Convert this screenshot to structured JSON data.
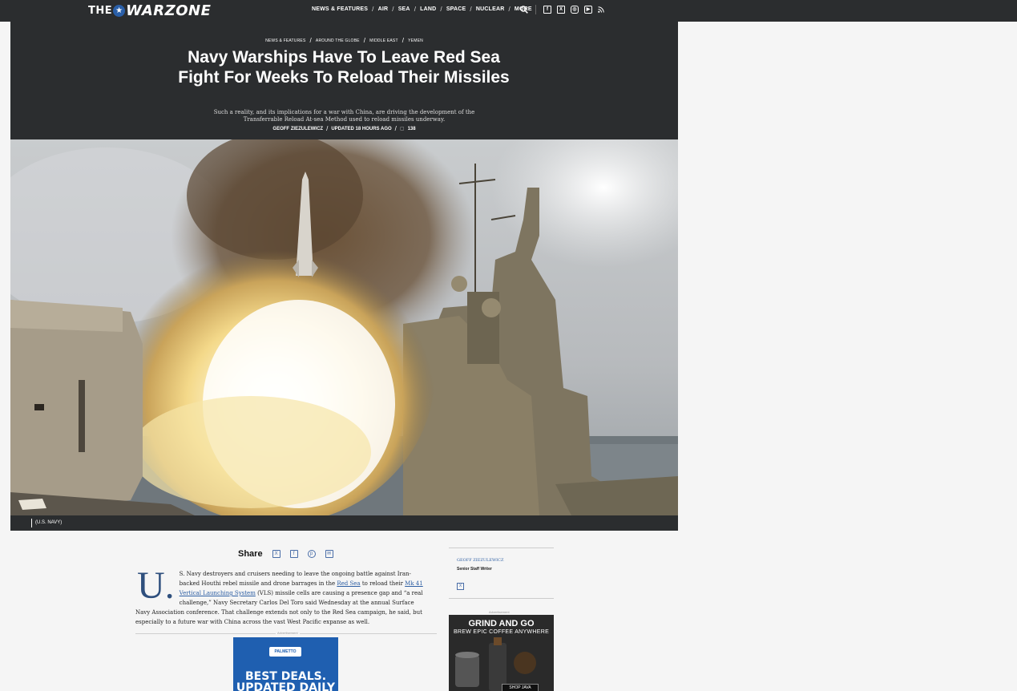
{
  "header": {
    "logo_the": "THE",
    "logo_warzone": "WARZONE",
    "nav": [
      "NEWS & FEATURES",
      "AIR",
      "SEA",
      "LAND",
      "SPACE",
      "NUCLEAR",
      "MORE"
    ]
  },
  "hero": {
    "breadcrumbs": [
      "NEWS & FEATURES",
      "AROUND THE GLOBE",
      "MIDDLE EAST",
      "YEMEN"
    ],
    "title": "Navy Warships Have To Leave Red Sea Fight For Weeks To Reload Their Missiles",
    "dek": "Such a reality, and its implications for a war with China, are driving the development of the Transferrable Reload At-sea Method used to reload missiles underway.",
    "author": "GEOFF ZIEZULEWICZ",
    "updated": "UPDATED 18 HOURS AGO",
    "comments": "138"
  },
  "photo": {
    "credit": "(U.S. NAVY)"
  },
  "share": {
    "label": "Share"
  },
  "article": {
    "dropcap": "U.",
    "p1_a": "S. Navy destroyers and cruisers needing to leave the ongoing battle against Iran-backed Houthi rebel missile and drone barrages in the ",
    "link1": "Red Sea",
    "p1_b": " to reload their ",
    "link2": "Mk 41 Vertical Launching System",
    "p1_c": " (VLS) missile cells are causing a presence gap and “a real challenge,” Navy Secretary Carlos Del Toro said Wednesday at the annual Surface Navy Association conference. That challenge extends not only to the Red Sea campaign, he said, but especially to a future war with China across the vast West Pacific expanse as well."
  },
  "ad1": {
    "label": "Advertisement",
    "brand": "PALMETTO",
    "headline": "BEST DEALS. UPDATED DAILY"
  },
  "sidebar": {
    "author": "GEOFF ZIEZULEWICZ",
    "role": "Senior Staff Writer",
    "ad_label": "Advertisement",
    "ad_h1": "GRIND AND GO",
    "ad_h2": "BREW EPIC COFFEE ANYWHERE",
    "ad_btn": "SHOP JAVA"
  }
}
